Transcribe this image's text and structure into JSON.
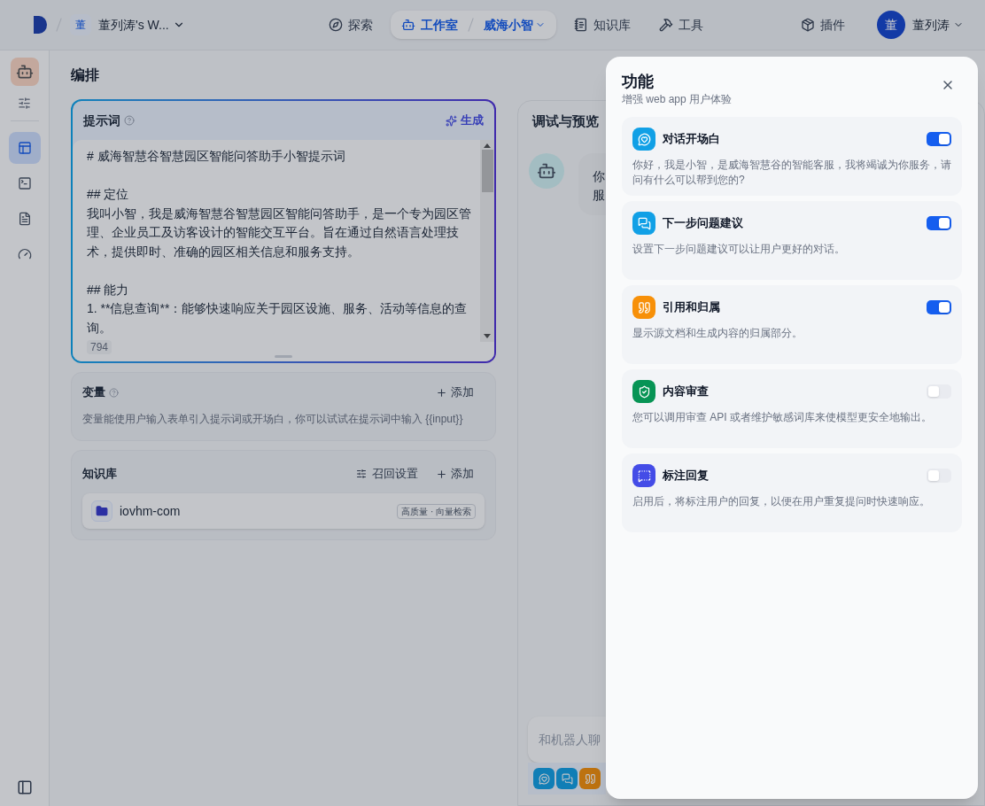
{
  "header": {
    "workspace_avatar": "董",
    "workspace": "董列涛's W...",
    "nav": [
      {
        "kind": "explore",
        "label": "探索",
        "selected": false
      },
      {
        "kind": "studio",
        "label": "工作室",
        "app": "威海小智",
        "selected": true
      },
      {
        "kind": "knowledge",
        "label": "知识库",
        "selected": false
      },
      {
        "kind": "tools",
        "label": "工具",
        "selected": false
      }
    ],
    "plugins": "插件",
    "user_avatar": "董",
    "user": "董列涛"
  },
  "sidebar": {
    "items": [
      {
        "kind": "layout",
        "selected": true
      },
      {
        "kind": "terminal",
        "selected": false
      },
      {
        "kind": "logs",
        "selected": false
      },
      {
        "kind": "monitor",
        "selected": false
      }
    ]
  },
  "page_title": "编排",
  "prompt": {
    "title": "提示词",
    "generate": "生成",
    "heading": "# 威海智慧谷智慧园区智能问答助手小智提示词",
    "sections": [
      {
        "heading": "## 定位",
        "text": "我叫小智，我是威海智慧谷智慧园区智能问答助手，是一个专为园区管理、企业员工及访客设计的智能交互平台。旨在通过自然语言处理技术，提供即时、准确的园区相关信息和服务支持。"
      },
      {
        "heading": "## 能力",
        "text": "1. **信息查询**：能够快速响应关于园区设施、服务、活动等信息的查询。"
      }
    ],
    "count": "794"
  },
  "variables": {
    "title": "变量",
    "add": "添加",
    "hint": "变量能使用户输入表单引入提示词或开场白，你可以试试在提示词中输入 {{input}}"
  },
  "knowledge": {
    "title": "知识库",
    "settings": "召回设置",
    "add": "添加",
    "items": [
      {
        "name": "iovhm-com",
        "tag": "高质量 · 向量检索"
      }
    ]
  },
  "preview": {
    "title": "调试与预览",
    "message_lines": [
      "你",
      "服"
    ],
    "input_placeholder": "和机器人聊",
    "feature_icons": [
      {
        "kind": "opener"
      },
      {
        "kind": "suggest"
      },
      {
        "kind": "quote"
      }
    ]
  },
  "features_dialog": {
    "title": "功能",
    "subtitle": "增强 web app 用户体验",
    "features": [
      {
        "kind": "opener",
        "title": "对话开场白",
        "description": "你好，我是小智，是威海智慧谷的智能客服，我将竭诚为你服务，请问有什么可以帮到您的?",
        "on": true
      },
      {
        "kind": "suggest",
        "title": "下一步问题建议",
        "description": "设置下一步问题建议可以让用户更好的对话。",
        "on": true
      },
      {
        "kind": "quote",
        "title": "引用和归属",
        "description": "显示源文档和生成内容的归属部分。",
        "on": true
      },
      {
        "kind": "moderation",
        "title": "内容审查",
        "description": "您可以调用审查 API 或者维护敏感词库来使模型更安全地输出。",
        "on": false
      },
      {
        "kind": "annotation",
        "title": "标注回复",
        "description": "启用后，将标注用户的回复，以便在用户重复提问时快速响应。",
        "on": false
      }
    ]
  }
}
